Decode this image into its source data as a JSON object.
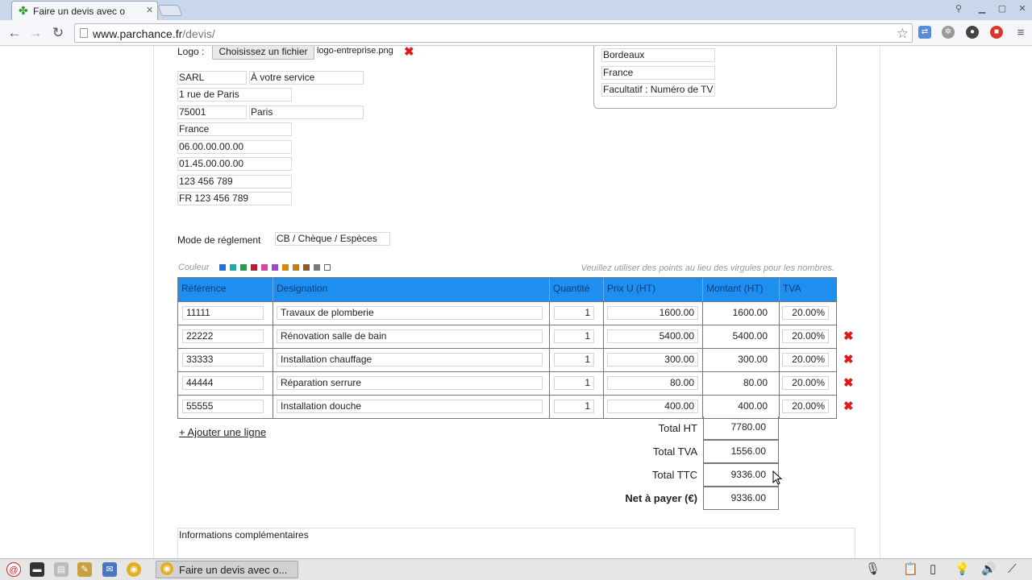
{
  "browser": {
    "tab_title": "Faire un devis avec o",
    "url_host": "www.parchance.fr",
    "url_path": "/devis/"
  },
  "company": {
    "logo_label": "Logo :",
    "file_button": "Choisissez un fichier",
    "file_name": "logo-entreprise.png",
    "legal_form": "SARL",
    "name": "À votre service",
    "street": "1 rue de Paris",
    "postal_code": "75001",
    "city": "Paris",
    "country": "France",
    "phone": "06.00.00.00.00",
    "fax": "01.45.00.00.00",
    "siren": "123 456 789",
    "vat_number": "FR 123 456 789"
  },
  "client": {
    "city": "Bordeaux",
    "country": "France",
    "vat_placeholder": "Facultatif : Numéro de TV"
  },
  "payment": {
    "label": "Mode de réglement",
    "value": "CB / Chèque / Espèces"
  },
  "colors": {
    "label": "Couleur",
    "swatches": [
      "#2a6fd6",
      "#2aa6a0",
      "#2a9d4a",
      "#b8202f",
      "#d14aa2",
      "#9a4ad1",
      "#d08a10",
      "#c47a1e",
      "#8c5a2c",
      "#7a7a7a",
      "#ffffff"
    ]
  },
  "hint": "Veuillez utiliser des points au lieu des virgules pour les nombres.",
  "table": {
    "headers": [
      "Référence",
      "Designation",
      "Quantité",
      "Prix U (HT)",
      "Montant (HT)",
      "TVA"
    ],
    "rows": [
      {
        "ref": "11111",
        "designation": "Travaux de plomberie",
        "qty": "1",
        "unit_price": "1600.00",
        "amount": "1600.00",
        "vat": "20.00%"
      },
      {
        "ref": "22222",
        "designation": "Rénovation salle de bain",
        "qty": "1",
        "unit_price": "5400.00",
        "amount": "5400.00",
        "vat": "20.00%"
      },
      {
        "ref": "33333",
        "designation": "Installation chauffage",
        "qty": "1",
        "unit_price": "300.00",
        "amount": "300.00",
        "vat": "20.00%"
      },
      {
        "ref": "44444",
        "designation": "Réparation serrure",
        "qty": "1",
        "unit_price": "80.00",
        "amount": "80.00",
        "vat": "20.00%"
      },
      {
        "ref": "55555",
        "designation": "Installation douche",
        "qty": "1",
        "unit_price": "400.00",
        "amount": "400.00",
        "vat": "20.00%"
      }
    ]
  },
  "add_line": "+ Ajouter une ligne",
  "totals": {
    "ht_label": "Total HT",
    "ht": "7780.00",
    "tva_label": "Total TVA",
    "tva": "1556.00",
    "ttc_label": "Total TTC",
    "ttc": "9336.00",
    "net_label": "Net à payer (€)",
    "net": "9336.00"
  },
  "info_label": "Informations complémentaires",
  "taskbar": {
    "task_label": "Faire un devis avec o..."
  }
}
